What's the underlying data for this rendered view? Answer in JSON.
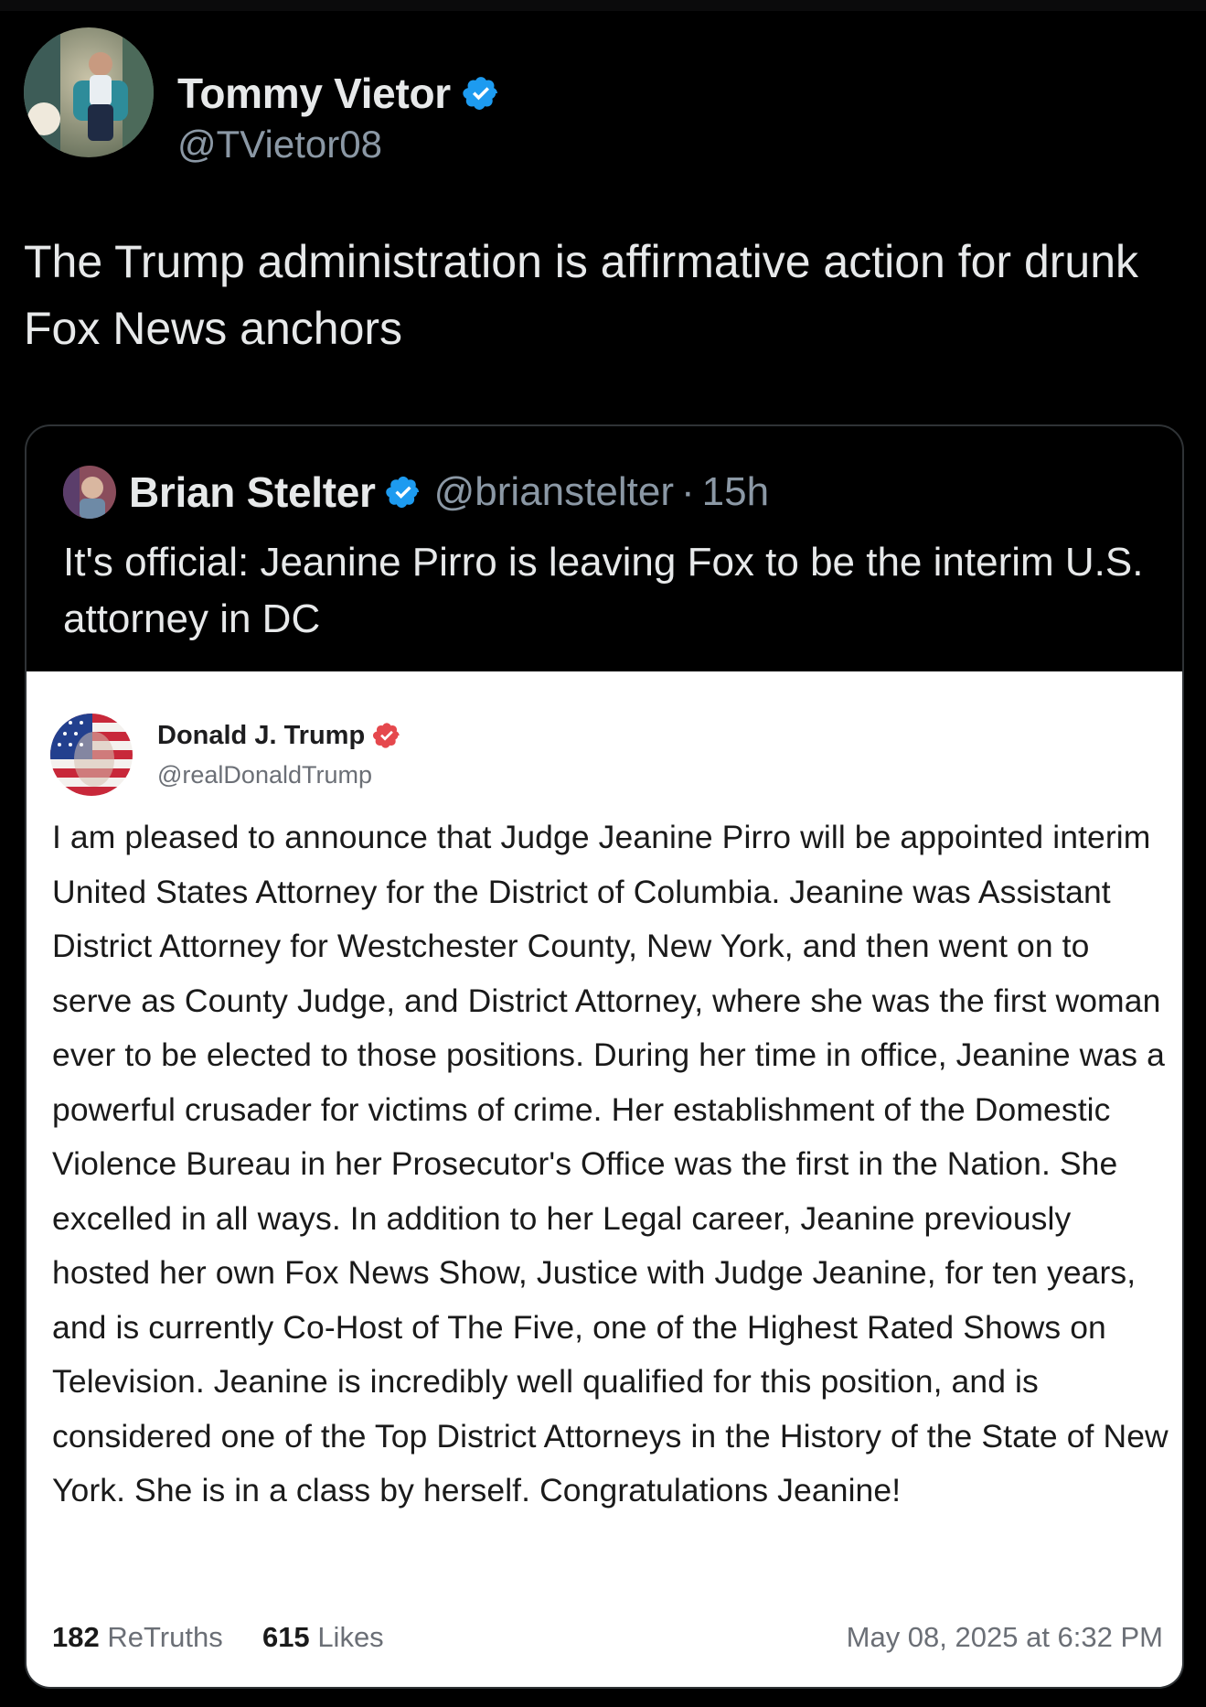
{
  "post": {
    "author_name": "Tommy Vietor",
    "author_handle": "@TVietor08",
    "avatar_icon": "profile-photo-icon",
    "verified_icon": "verified-badge-icon",
    "text": "The Trump administration is affirmative action for drunk Fox News anchors"
  },
  "quoted": {
    "author_name": "Brian Stelter",
    "author_handle": "@brianstelter",
    "separator": "·",
    "time": "15h",
    "text": "It's official: Jeanine Pirro is leaving Fox to be the interim U.S. attorney in DC"
  },
  "embedded_post": {
    "author_name": "Donald J. Trump",
    "author_handle": "@realDonaldTrump",
    "body": "I am pleased to announce that Judge Jeanine Pirro will be appointed interim United States Attorney for the District of Columbia. Jeanine was Assistant District Attorney for Westchester County, New York, and then went on to serve as County Judge, and District Attorney, where she was the first woman ever to be elected to those positions. During her time in office, Jeanine was a powerful crusader for victims of crime. Her establishment of the Domestic Violence Bureau in her Prosecutor's Office was the first in the Nation. She excelled in all ways. In addition to her Legal career, Jeanine previously hosted her own Fox News Show, Justice with Judge Jeanine, for ten years, and is currently Co-Host of The Five, one of the Highest Rated Shows on Television. Jeanine is incredibly well qualified for this position, and is considered one of the Top District Attorneys in the History of the State of New York. She is in a class by herself. Congratulations Jeanine!",
    "retruths_count": "182",
    "retruths_label": "ReTruths",
    "likes_count": "615",
    "likes_label": "Likes",
    "date": "May 08, 2025 at 6:32 PM"
  },
  "colors": {
    "background": "#000000",
    "primary_text": "#e7e9ea",
    "secondary_text": "#8b98a5",
    "verified_blue": "#1d9bf0",
    "truth_verified": "#e5484d",
    "card_border": "#2f3336"
  }
}
